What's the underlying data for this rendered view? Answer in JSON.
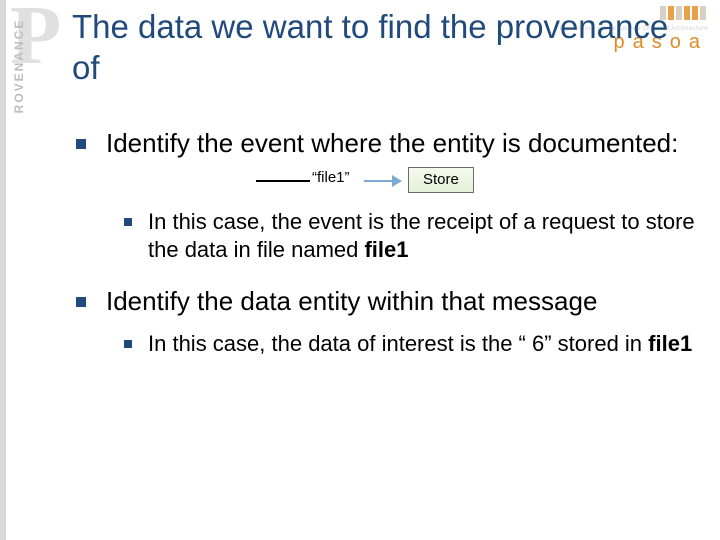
{
  "logo": {
    "side_text": "ROVENANCE",
    "big_letter": "P",
    "pasoa_smallwords": "Provenance Aware Service Oriented Architecture",
    "pasoa_word": "pasoa"
  },
  "title": "The data we want to find the provenance of",
  "bullet1": {
    "text": "Identify the event where the entity is documented:",
    "diagram": {
      "file_label": "“file1”",
      "store_label": "Store"
    },
    "sub": {
      "pre": "In this case, the event is the receipt of a request to store the data in file named ",
      "bold": "file1"
    }
  },
  "bullet2": {
    "text": "Identify the data entity within that message",
    "sub": {
      "pre": "In this case, the data of interest is the “ 6” stored in ",
      "bold": "file1"
    }
  }
}
